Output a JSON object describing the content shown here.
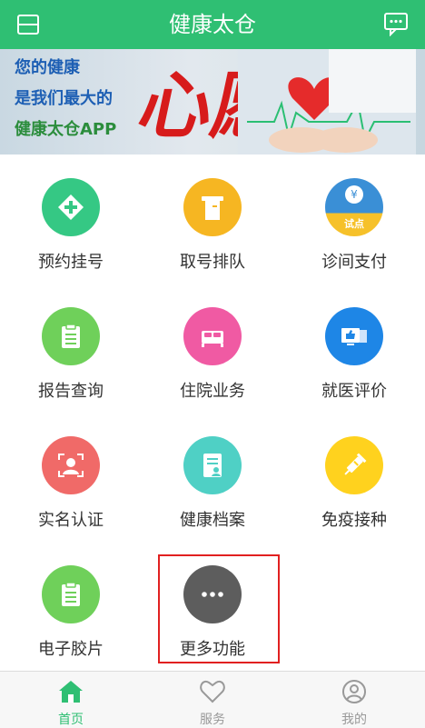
{
  "header": {
    "title": "健康太仓",
    "left_icon": "scan-icon",
    "right_icon": "message-icon"
  },
  "banner": {
    "line1": "您的健康",
    "line2": "是我们最大的",
    "line3": "健康太仓APP",
    "slogan": "心愿"
  },
  "services": [
    {
      "label": "预约挂号",
      "icon": "plus-cross-icon",
      "color": "#35c884"
    },
    {
      "label": "取号排队",
      "icon": "ticket-icon",
      "color": "#f6b622"
    },
    {
      "label": "诊间支付",
      "icon": "yuan-icon",
      "color": "#3a8fd6",
      "badge": "试点"
    },
    {
      "label": "报告查询",
      "icon": "clipboard-icon",
      "color": "#6fd05a"
    },
    {
      "label": "住院业务",
      "icon": "bed-icon",
      "color": "#f05aa3"
    },
    {
      "label": "就医评价",
      "icon": "thumbs-up-monitor-icon",
      "color": "#1e86e6"
    },
    {
      "label": "实名认证",
      "icon": "face-scan-icon",
      "color": "#f06a68"
    },
    {
      "label": "健康档案",
      "icon": "records-icon",
      "color": "#4fd0c5"
    },
    {
      "label": "免疫接种",
      "icon": "syringe-icon",
      "color": "#ffd21e"
    },
    {
      "label": "电子胶片",
      "icon": "clipboard-icon",
      "color": "#6fd05a"
    },
    {
      "label": "更多功能",
      "icon": "more-dots-icon",
      "color": "#5d5d5d"
    }
  ],
  "tabbar": {
    "items": [
      {
        "label": "首页",
        "icon": "home-icon",
        "active": true
      },
      {
        "label": "服务",
        "icon": "heart-icon",
        "active": false
      },
      {
        "label": "我的",
        "icon": "user-icon",
        "active": false
      }
    ]
  },
  "colors": {
    "brand": "#2fbf73",
    "highlight": "#e12020"
  }
}
